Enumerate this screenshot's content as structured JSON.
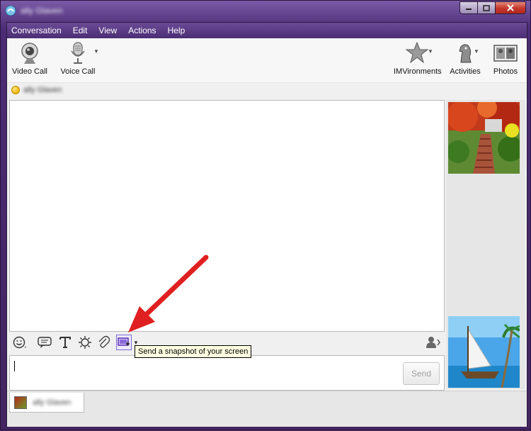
{
  "window": {
    "title": "ally Glaven",
    "minimize_icon": "minimize-icon",
    "maximize_icon": "maximize-icon",
    "close_icon": "close-icon"
  },
  "menu": [
    "Conversation",
    "Edit",
    "View",
    "Actions",
    "Help"
  ],
  "toolbar": {
    "video_call": "Video Call",
    "voice_call": "Voice Call",
    "imvironments": "IMVironments",
    "activities": "Activities",
    "photos": "Photos"
  },
  "contact": {
    "name": "ally Glaven",
    "status_color": "#f0b400"
  },
  "format_bar": {
    "icons": [
      "emoticon-icon",
      "nudge-icon",
      "text-format-icon",
      "audibles-icon",
      "attach-icon",
      "snapshot-icon",
      "contact-info-icon"
    ]
  },
  "tooltip": {
    "text": "Send a snapshot of your screen"
  },
  "input": {
    "value": "",
    "send_label": "Send"
  },
  "tabs": [
    {
      "label": "ally Glaven"
    }
  ],
  "colors": {
    "accent": "#4b2e74",
    "arrow": "#e02020"
  }
}
